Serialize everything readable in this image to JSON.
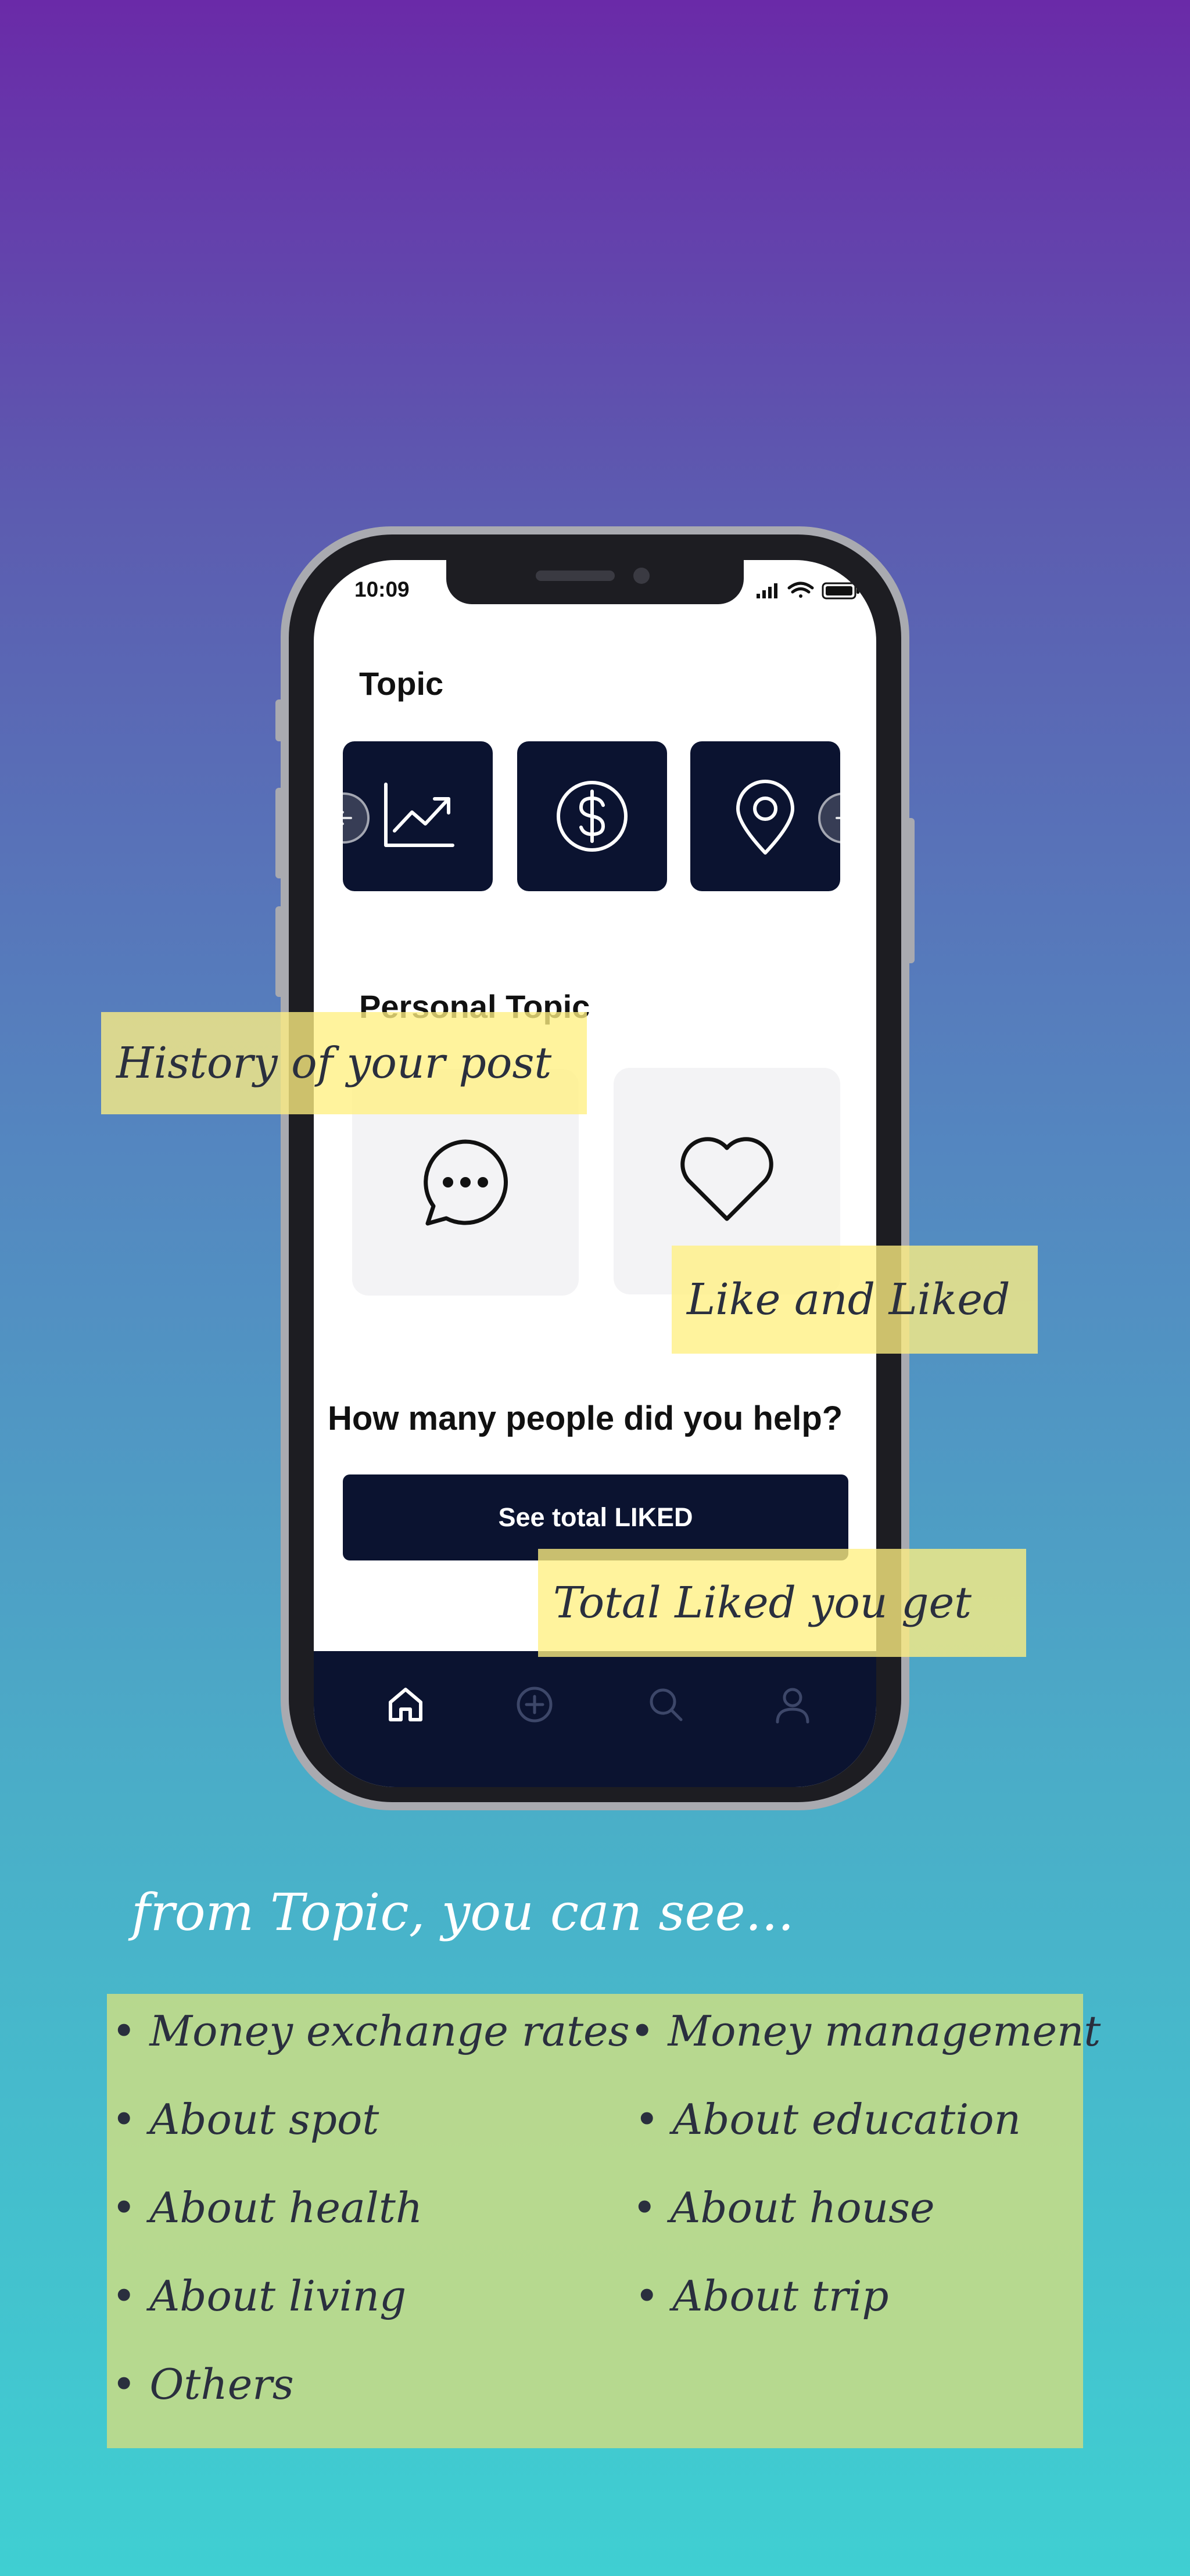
{
  "phone": {
    "status_time": "10:09",
    "topic_title": "Topic",
    "topics": [
      {
        "icon": "chart-trend-icon"
      },
      {
        "icon": "dollar-icon"
      },
      {
        "icon": "location-pin-icon"
      }
    ],
    "personal_title": "Personal Topic",
    "personal_cards": [
      {
        "icon": "chat-bubble-icon"
      },
      {
        "icon": "heart-icon"
      }
    ],
    "help_question": "How many people did you help?",
    "cta_label": "See total LIKED",
    "tabs": [
      {
        "icon": "home-icon"
      },
      {
        "icon": "add-circle-icon"
      },
      {
        "icon": "search-icon"
      },
      {
        "icon": "profile-icon"
      }
    ]
  },
  "notes": {
    "history": "History of your post",
    "like": "Like and Liked",
    "total": "Total Liked you get"
  },
  "subtitle": "from Topic, you can see...",
  "list": {
    "left": [
      "• Money exchange rates",
      "• About spot",
      "• About health",
      "• About living",
      "• Others"
    ],
    "right": [
      "• Money management",
      "• About education",
      "• About house",
      "• About trip"
    ]
  },
  "colors": {
    "dark_navy": "#0b1330",
    "note_yellow": "#fff082",
    "list_green": "#bfda8a"
  }
}
